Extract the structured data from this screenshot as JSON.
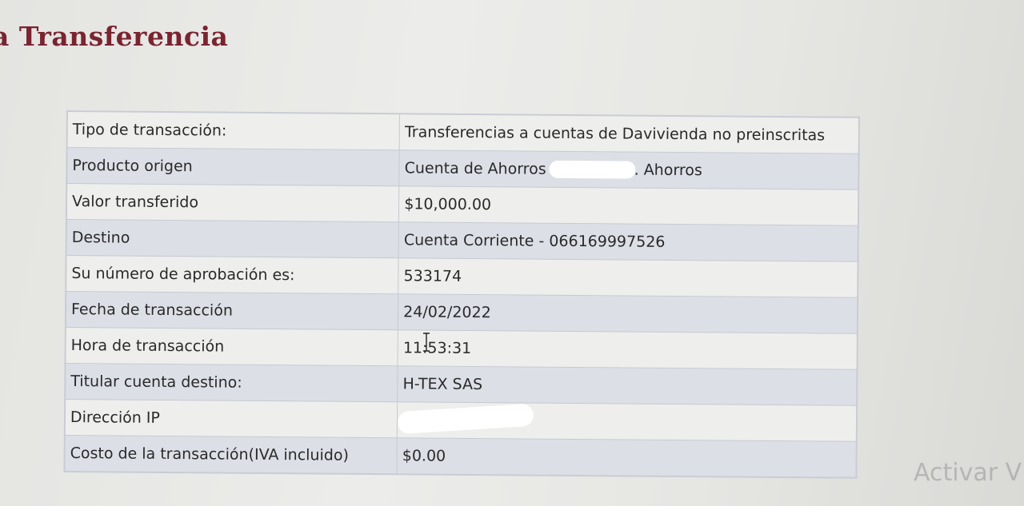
{
  "page": {
    "title": "a Transferencia"
  },
  "receipt": {
    "rows": [
      {
        "label": "Tipo de transacción:",
        "value": "Transferencias a cuentas de Davivienda no preinscritas"
      },
      {
        "label": "Producto origen",
        "value_prefix": "Cuenta de Ahorros",
        "value_suffix": ". Ahorros"
      },
      {
        "label": "Valor transferido",
        "value": "$10,000.00"
      },
      {
        "label": "Destino",
        "value": "Cuenta Corriente - 066169997526"
      },
      {
        "label": "Su número de aprobación es:",
        "value": "533174"
      },
      {
        "label": "Fecha de transacción",
        "value": "24/02/2022"
      },
      {
        "label": "Hora de transacción",
        "value": "11:53:31"
      },
      {
        "label": "Titular cuenta destino:",
        "value": "H-TEX SAS"
      },
      {
        "label": "Dirección IP",
        "value": ""
      },
      {
        "label": "Costo de la transacción(IVA incluido)",
        "value": "$0.00"
      }
    ]
  },
  "watermark": {
    "text": "Activar V"
  },
  "colors": {
    "title": "#7a2430",
    "row_alt": "#dcdfe6",
    "border": "#c6c9d2"
  }
}
